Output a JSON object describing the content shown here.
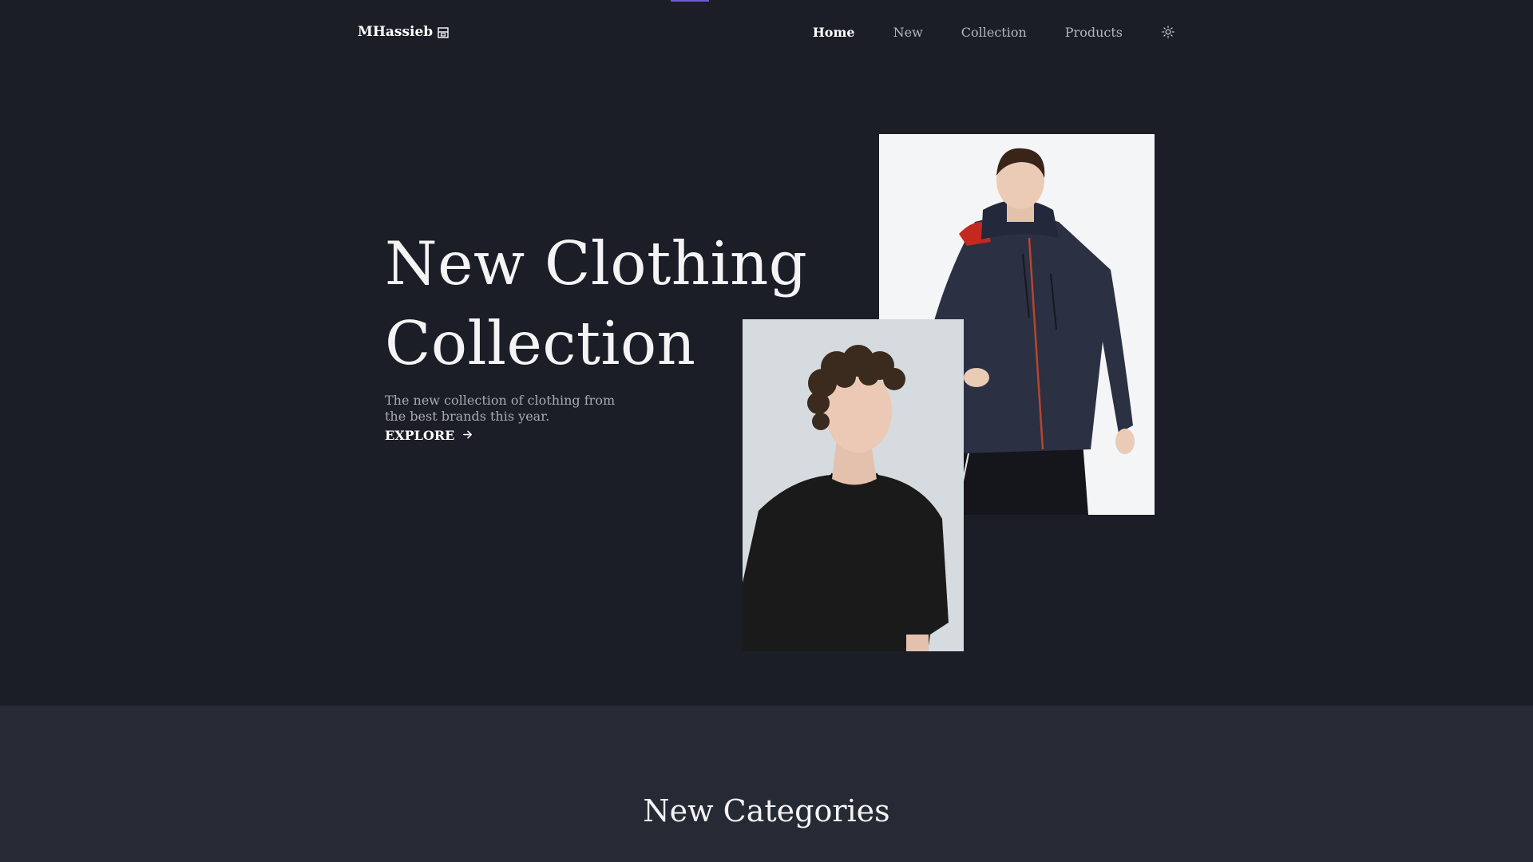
{
  "header": {
    "logo_text": "MHassieb",
    "logo_icon": "store-icon",
    "nav": [
      {
        "label": "Home",
        "active": true
      },
      {
        "label": "New",
        "active": false
      },
      {
        "label": "Collection",
        "active": false
      },
      {
        "label": "Products",
        "active": false
      }
    ],
    "theme_icon": "sun-icon"
  },
  "hero": {
    "title_line1": "New Clothing",
    "title_line2": "Collection",
    "description": "The new collection of clothing from the best brands this year.",
    "cta_label": "EXPLORE",
    "cta_icon": "arrow-right-icon"
  },
  "categories": {
    "title": "New Categories"
  },
  "colors": {
    "background": "#1b1e27",
    "section_background": "#262a35",
    "accent": "#6d5bd0"
  }
}
